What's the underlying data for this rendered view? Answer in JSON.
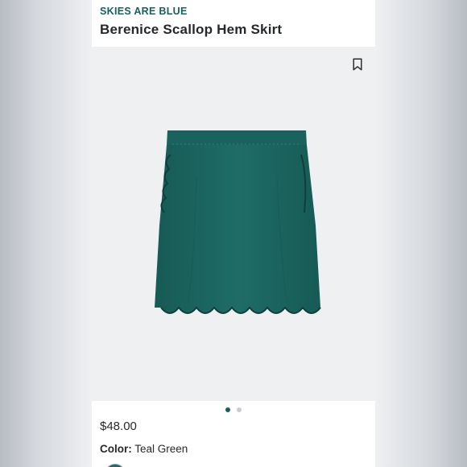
{
  "product": {
    "brand": "SKIES ARE BLUE",
    "name": "Berenice Scallop Hem Skirt",
    "price": "$48.00",
    "color_label": "Color:",
    "color_value": "Teal Green"
  },
  "carousel": {
    "total_images": 2,
    "active_index": 0
  },
  "icons": {
    "bookmark": "bookmark-icon"
  },
  "colors": {
    "brand": "#16605f",
    "skirt": "#1d6862",
    "image_bg": "#eef0f2"
  }
}
